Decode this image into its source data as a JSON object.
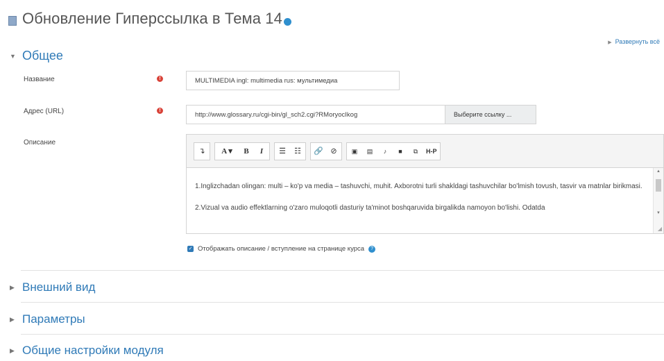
{
  "page": {
    "title": "Обновление Гиперссылка в Тема 14",
    "expand_all": "Развернуть всё"
  },
  "general": {
    "heading": "Общее",
    "name_label": "Название",
    "name_value": "MULTIMEDIA ingl: multimedia rus: мультимедиа",
    "url_label": "Адрес (URL)",
    "url_value": "http://www.glossary.ru/cgi-bin/gl_sch2.cgi?RMoryocIkog",
    "choose_link": "Выберите ссылку ...",
    "description_label": "Описание",
    "description_paragraphs": [
      "1.Inglizchadan olingan: multi – ko'p va media – tashuvchi, muhit. Axborotni turli shakldagi tashuvchilar bo'lmish tovush, tasvir va matnlar birikmasi.",
      "2.Vizual va audio effektlarning o'zaro muloqotli dasturiy ta'minot boshqaruvida birgalikda namoyon bo'lishi. Odatda"
    ],
    "show_description": "Отображать описание / вступление на странице курса",
    "show_description_checked": true
  },
  "toolbar": {
    "a_label": "A",
    "bold": "B",
    "italic": "I",
    "h5p": "H-P"
  },
  "sections": {
    "appearance": "Внешний вид",
    "parameters": "Параметры",
    "common_settings": "Общие настройки модуля"
  },
  "colors": {
    "link": "#2f7ab7",
    "required": "#d9443a"
  }
}
